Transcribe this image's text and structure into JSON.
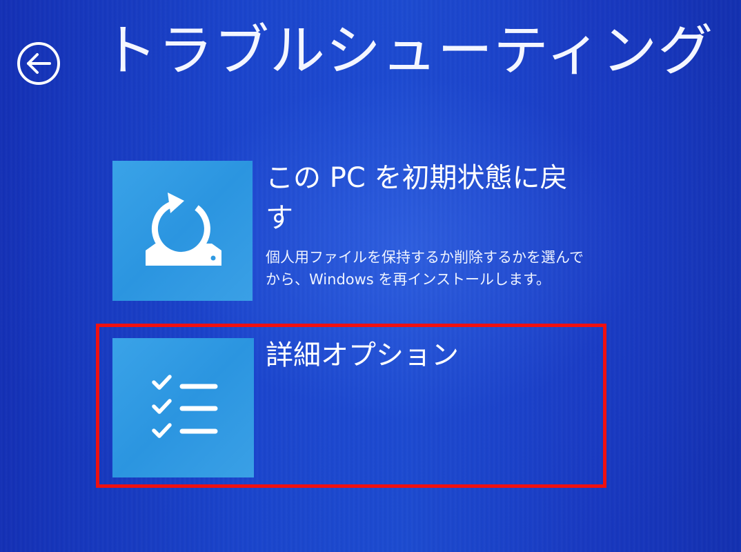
{
  "header": {
    "title": "トラブルシューティング",
    "back_icon": "back-arrow-circle-icon"
  },
  "options": [
    {
      "icon": "reset-pc-icon",
      "title": "この PC を初期状態に戻す",
      "description": "個人用ファイルを保持するか削除するかを選んでから、Windows を再インストールします。"
    },
    {
      "icon": "advanced-options-checklist-icon",
      "title": "詳細オプション",
      "description": ""
    }
  ],
  "colors": {
    "background": "#1638c2",
    "tile": "#2f99e2",
    "highlight": "#f01010",
    "text": "#ffffff"
  }
}
